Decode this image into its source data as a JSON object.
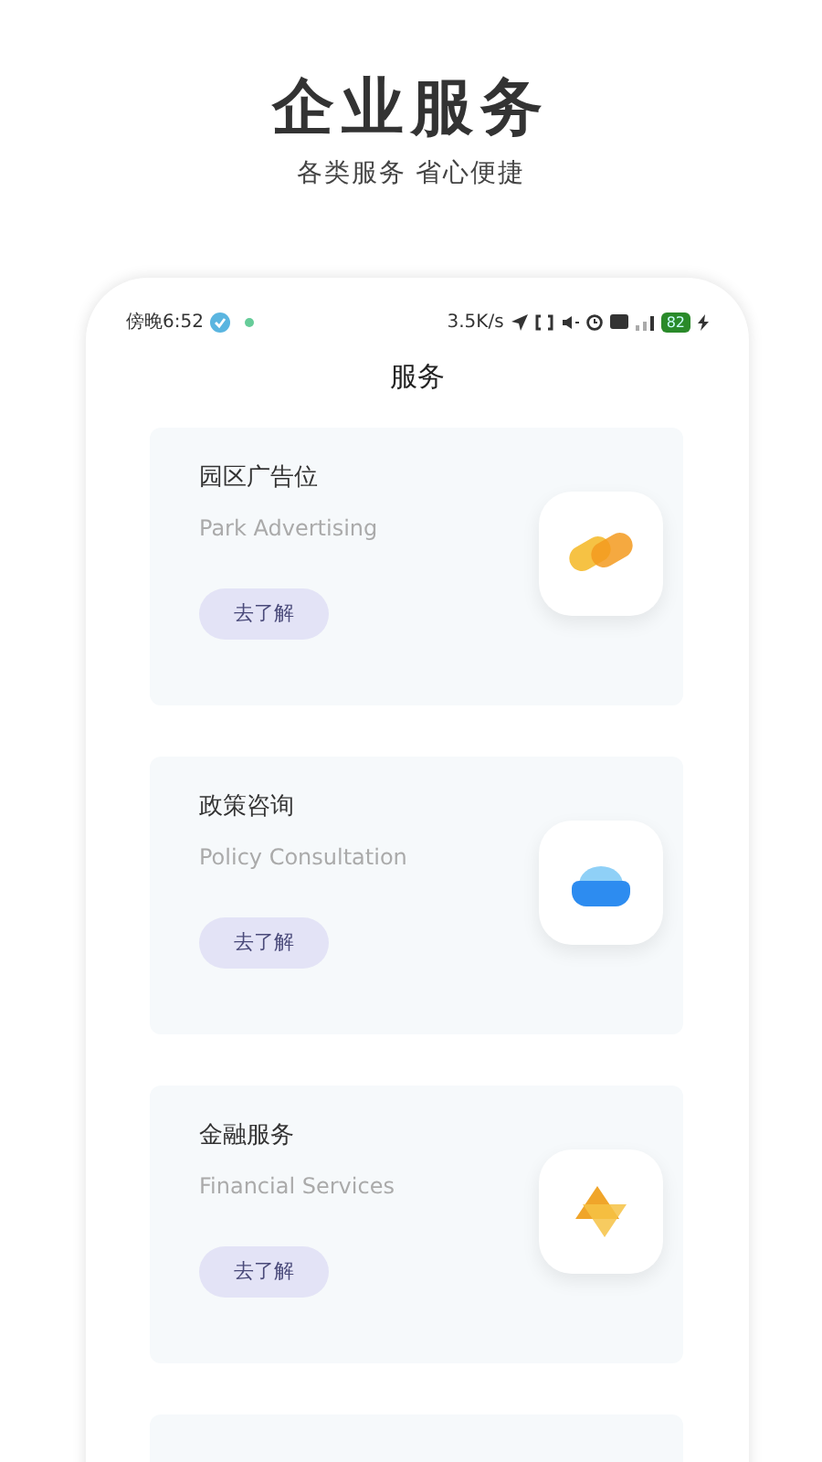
{
  "header": {
    "title": "企业服务",
    "subtitle": "各类服务 省心便捷"
  },
  "status_bar": {
    "time": "傍晚6:52",
    "speed": "3.5K/s",
    "battery": "82"
  },
  "screen_title": "服务",
  "cards": [
    {
      "title": "园区广告位",
      "subtitle": "Park Advertising",
      "button": "去了解"
    },
    {
      "title": "政策咨询",
      "subtitle": "Policy Consultation",
      "button": "去了解"
    },
    {
      "title": "金融服务",
      "subtitle": "Financial Services",
      "button": "去了解"
    }
  ]
}
